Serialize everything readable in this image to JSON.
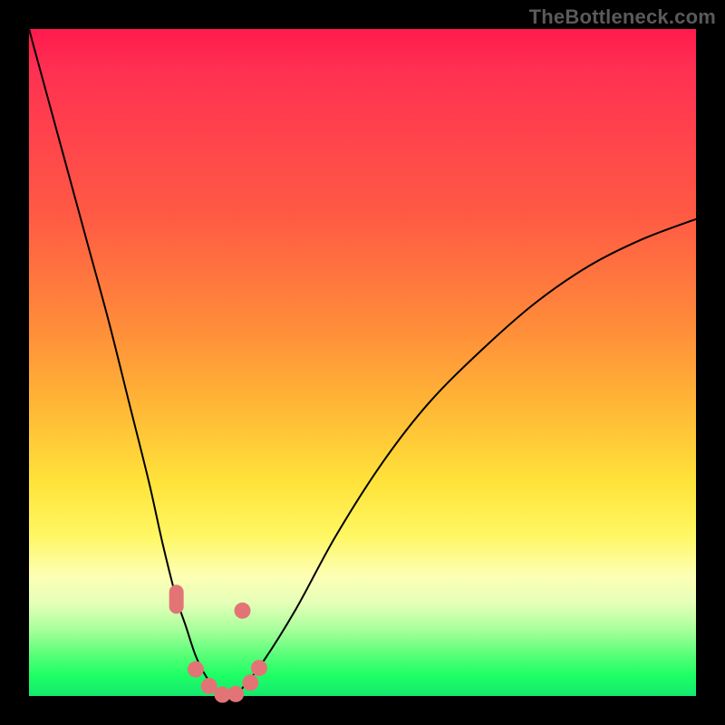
{
  "watermark": "TheBottleneck.com",
  "colors": {
    "frame": "#000000",
    "marker": "#e37476",
    "curve": "#000000"
  },
  "chart_data": {
    "type": "line",
    "title": "",
    "xlabel": "",
    "ylabel": "",
    "xlim": [
      0,
      100
    ],
    "ylim": [
      0,
      100
    ],
    "x": [
      0,
      3,
      6,
      9,
      12,
      15,
      18,
      20,
      22,
      23.5,
      25,
      26.5,
      28,
      29,
      30,
      31,
      32,
      35,
      40,
      46,
      53,
      60,
      68,
      76,
      84,
      92,
      100
    ],
    "y": [
      100,
      89,
      78,
      67,
      56,
      44,
      32,
      23,
      15,
      10.5,
      6,
      3,
      1,
      0.3,
      0,
      0.3,
      1.2,
      5,
      13,
      24,
      35,
      44,
      52,
      59,
      64.5,
      68.5,
      71.5
    ],
    "markers": [
      {
        "x": 22.1,
        "y": 14.5,
        "shape": "pill-v"
      },
      {
        "x": 25.0,
        "y": 4.0,
        "shape": "dot"
      },
      {
        "x": 27.0,
        "y": 1.5,
        "shape": "dot"
      },
      {
        "x": 29.0,
        "y": 0.2,
        "shape": "dot"
      },
      {
        "x": 31.0,
        "y": 0.3,
        "shape": "dot"
      },
      {
        "x": 33.2,
        "y": 2.0,
        "shape": "dot"
      },
      {
        "x": 34.5,
        "y": 4.2,
        "shape": "dot"
      },
      {
        "x": 32.0,
        "y": 12.8,
        "shape": "dot"
      }
    ]
  }
}
